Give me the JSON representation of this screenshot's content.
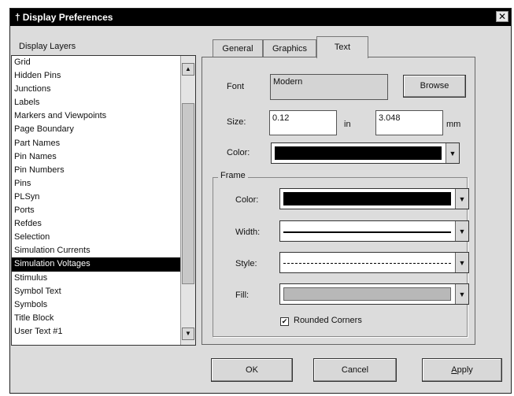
{
  "window": {
    "title": "Display Preferences",
    "title_glyph": "†",
    "close_glyph": "✕"
  },
  "layers": {
    "label": "Display Layers",
    "items": [
      "Grid",
      "Hidden Pins",
      "Junctions",
      "Labels",
      "Markers and Viewpoints",
      "Page Boundary",
      "Part Names",
      "Pin Names",
      "Pin Numbers",
      "Pins",
      "PLSyn",
      "Ports",
      "Refdes",
      "Selection",
      "Simulation Currents",
      "Simulation Voltages",
      "Stimulus",
      "Symbol Text",
      "Symbols",
      "Title Block",
      "User Text #1"
    ],
    "selected": "Simulation Voltages"
  },
  "tabs": [
    {
      "label": "General"
    },
    {
      "label": "Graphics"
    },
    {
      "label": "Text",
      "active": true
    }
  ],
  "text_tab": {
    "font_label": "Font",
    "font_value": "Modern",
    "browse_label": "Browse",
    "size_label": "Size:",
    "size_in_value": "0.12",
    "size_in_unit": "in",
    "size_mm_value": "3.048",
    "size_mm_unit": "mm",
    "color_label": "Color:",
    "color_value": "#000000"
  },
  "frame": {
    "title": "Frame",
    "color_label": "Color:",
    "color_value": "#000000",
    "width_label": "Width:",
    "width_value": "solid",
    "style_label": "Style:",
    "style_value": "dashed",
    "fill_label": "Fill:",
    "fill_value": "#b8b8b8",
    "rounded_label": "Rounded Corners",
    "rounded_checked": true,
    "check_glyph": "✔"
  },
  "buttons": {
    "ok": "OK",
    "cancel": "Cancel",
    "apply": "Apply"
  },
  "icons": {
    "scroll_up": "▲",
    "scroll_down": "▼",
    "combo_arrow": "▼"
  }
}
